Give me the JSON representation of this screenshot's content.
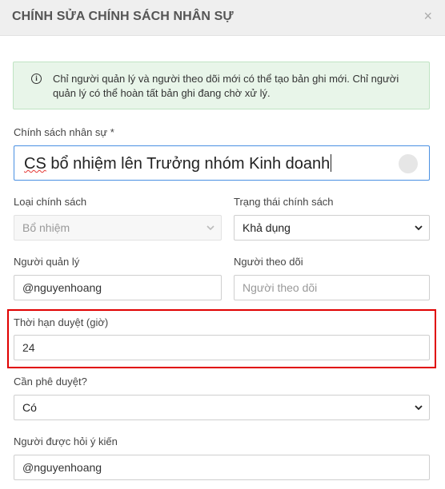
{
  "dialog": {
    "title": "CHÍNH SỬA CHÍNH SÁCH NHÂN SỰ",
    "close_icon": "close-icon",
    "close_glyph": "×"
  },
  "alert": {
    "icon": "info-icon",
    "icon_glyph": "i",
    "text": "Chỉ người quản lý và người theo dõi mới có thể tạo bản ghi mới. Chỉ người quản lý có thể hoàn tất bản ghi đang chờ xử lý."
  },
  "form": {
    "policy": {
      "label": "Chính sách nhân sự *",
      "value_prefix": "CS",
      "value_rest": " bổ nhiệm lên Trưởng nhóm Kinh doanh"
    },
    "policy_type": {
      "label": "Loại chính sách",
      "value": "Bổ nhiệm",
      "disabled": true
    },
    "policy_status": {
      "label": "Trạng thái chính sách",
      "value": "Khả dụng"
    },
    "manager": {
      "label": "Người quản lý",
      "value": "@nguyenhoang"
    },
    "follower": {
      "label": "Người theo dõi",
      "placeholder": "Người theo dõi",
      "value": ""
    },
    "approval_deadline": {
      "label": "Thời hạn duyệt (giờ)",
      "value": "24"
    },
    "needs_approval": {
      "label": "Cần phê duyệt?",
      "value": "Có"
    },
    "consultee": {
      "label": "Người được hỏi ý kiến",
      "value": "@nguyenhoang"
    }
  },
  "colors": {
    "header_bg": "#efefef",
    "alert_bg": "#e8f5e9",
    "focus_border": "#4a90e2",
    "highlight": "#e00000"
  }
}
